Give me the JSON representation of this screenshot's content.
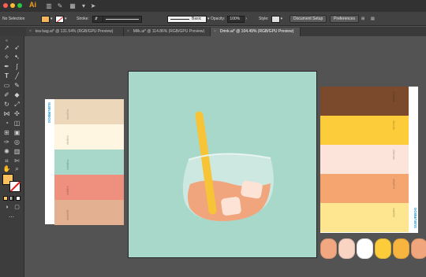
{
  "app": {
    "logo": "Ai"
  },
  "controlbar": {
    "selection_label": "No Selection",
    "fill_color": "#f4b65d",
    "stroke_label": "Stroke:",
    "brush_label": "Basic",
    "opacity_label": "Opacity:",
    "opacity_value": "100%",
    "style_label": "Style:",
    "document_setup": "Document Setup",
    "preferences": "Preferences"
  },
  "tabs": [
    {
      "label": "tea bag.ai* @ 131.54% (RGB/GPU Preview)"
    },
    {
      "label": "Milk.ai* @ 114.86% (RGB/GPU Preview)"
    },
    {
      "label": "Drink.ai* @ 104.49% (RGB/GPU Preview)"
    }
  ],
  "tools": {
    "fill_color": "#fbc15e",
    "stroke_color": "#ffffff"
  },
  "artwork": {
    "background": "#a8d8ca",
    "straw_color": "#f7c437",
    "liquid_color": "#f0a57c",
    "glass_color": "#cde8e1",
    "ice_color": "#fde2d6"
  },
  "palette_left": {
    "brand": "SUBURBOO",
    "swatches": [
      {
        "color": "#ecd7bb",
        "code": "#ecd7bb"
      },
      {
        "color": "#fef6e0",
        "code": "#fef6e0"
      },
      {
        "color": "#a8d8ca",
        "code": "#a8d8ca"
      },
      {
        "color": "#ef8f7e",
        "code": "#ef8f7e"
      },
      {
        "color": "#e4b092",
        "code": "#e4b092"
      }
    ]
  },
  "palette_right": {
    "brand": "SUBURBOO",
    "swatches": [
      {
        "color": "#7b4a2c",
        "code": "#7b4a2c"
      },
      {
        "color": "#fccc3b",
        "code": "#fccc3b"
      },
      {
        "color": "#fde4da",
        "code": "#fde4da"
      },
      {
        "color": "#f4a570",
        "code": "#f4a570"
      },
      {
        "color": "#fde68f",
        "code": "#fde68f"
      }
    ]
  },
  "color_dots": [
    "#f1a880",
    "#f9d4c2",
    "#ffffff",
    "#fccc3b",
    "#f7b43f",
    "#f0a57c"
  ]
}
